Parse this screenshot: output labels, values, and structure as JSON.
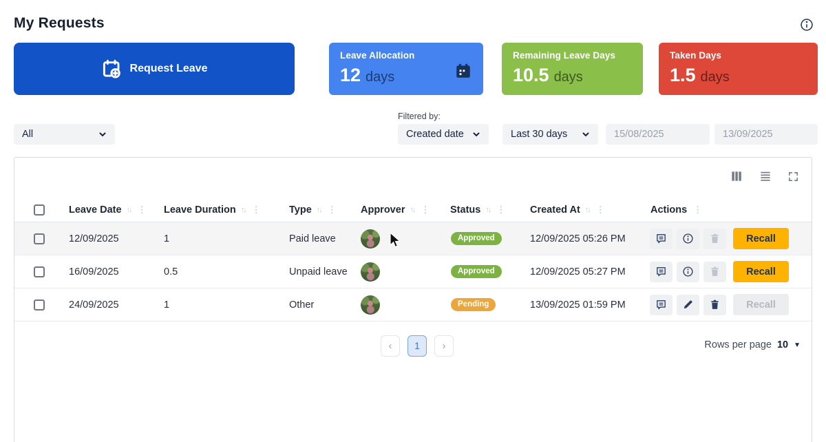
{
  "page": {
    "title": "My Requests"
  },
  "toolbar": {
    "request_leave_label": "Request Leave"
  },
  "stat_cards": [
    {
      "label": "Leave Allocation",
      "value": "12",
      "unit": "days",
      "color": "#4584f0"
    },
    {
      "label": "Remaining Leave Days",
      "value": "10.5",
      "unit": "days",
      "color": "#8abf4a"
    },
    {
      "label": "Taken Days",
      "value": "1.5",
      "unit": "days",
      "color": "#de4839"
    }
  ],
  "filters": {
    "type_filter_value": "All",
    "filtered_by_label": "Filtered by:",
    "field_filter_value": "Created date",
    "range_filter_value": "Last 30 days",
    "date_from": "15/08/2025",
    "date_to": "13/09/2025"
  },
  "table": {
    "columns": [
      {
        "label": "Leave Date"
      },
      {
        "label": "Leave Duration"
      },
      {
        "label": "Type"
      },
      {
        "label": "Approver"
      },
      {
        "label": "Status"
      },
      {
        "label": "Created At"
      },
      {
        "label": "Actions"
      }
    ],
    "recall_label": "Recall",
    "status_colors": {
      "Approved": "#7cb342",
      "Pending": "#eda63c"
    },
    "rows": [
      {
        "leave_date": "12/09/2025",
        "leave_duration": "1",
        "type": "Paid leave",
        "status": "Approved",
        "created_at": "12/09/2025 05:26 PM"
      },
      {
        "leave_date": "16/09/2025",
        "leave_duration": "0.5",
        "type": "Unpaid leave",
        "status": "Approved",
        "created_at": "12/09/2025 05:27 PM"
      },
      {
        "leave_date": "24/09/2025",
        "leave_duration": "1",
        "type": "Other",
        "status": "Pending",
        "created_at": "13/09/2025 01:59 PM"
      }
    ]
  },
  "pagination": {
    "current_page": "1",
    "rows_per_page_label": "Rows per page",
    "rows_per_page_value": "10"
  },
  "colors": {
    "primary_button": "#1254c8",
    "recall_active": "#ffb300"
  }
}
